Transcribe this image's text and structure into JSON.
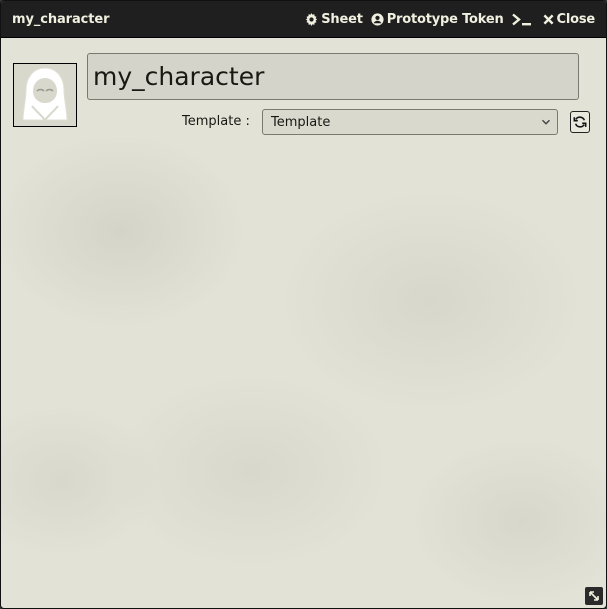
{
  "window": {
    "title": "my_character",
    "header_buttons": [
      {
        "label": "Sheet",
        "icon": "gear-icon"
      },
      {
        "label": "Prototype Token",
        "icon": "user-circle-icon"
      },
      {
        "label": "",
        "icon": "terminal-icon"
      },
      {
        "label": "Close",
        "icon": "close-icon"
      }
    ]
  },
  "sheet": {
    "avatar_icon": "hooded-figure-icon",
    "name_value": "my_character",
    "template_label": "Template :",
    "template_selected": "Template",
    "refresh_icon": "refresh-icon"
  },
  "colors": {
    "titlebar_bg": "#1f1f1f",
    "titlebar_text": "#f0f0e0",
    "sheet_bg": "#e2e2d7",
    "text": "#191813"
  }
}
